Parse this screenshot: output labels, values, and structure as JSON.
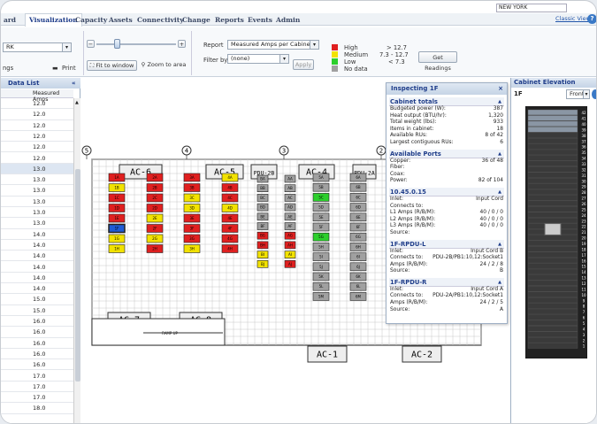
{
  "nav": {
    "items": [
      "ard",
      "Visualization",
      "Capacity",
      "Assets",
      "Connectivity",
      "Change",
      "Reports",
      "Events",
      "Admin"
    ],
    "sub": "ps",
    "location": "NEW YORK",
    "classic_view": "Classic View",
    "help": "?"
  },
  "toolbar": {
    "site_select": "RK",
    "rings": "ngs",
    "print": "Print",
    "minus": "−",
    "plus": "+",
    "fit_to_window": "Fit to window",
    "zoom_to_area": "Zoom to area",
    "report_label": "Report",
    "report_value": "Measured Amps per Cabinet",
    "filter_label": "Filter by",
    "filter_value": "(none)",
    "apply": "Apply",
    "get_readings": "Get Readings",
    "legend": [
      {
        "label": "High",
        "range": "> 12.7",
        "color": "#e02020"
      },
      {
        "label": "Medium",
        "range": "7.3 - 12.7",
        "color": "#f2e200"
      },
      {
        "label": "Low",
        "range": "< 7.3",
        "color": "#2ccf2c"
      },
      {
        "label": "No data",
        "range": "",
        "color": "#a0a0a0"
      }
    ]
  },
  "data_list": {
    "title": "Data List",
    "collapse": "«",
    "column": "Measured Amps",
    "rows": [
      "12.0",
      "12.0",
      "12.0",
      "12.0",
      "12.0",
      "12.0",
      "13.0",
      "13.0",
      "13.0",
      "13.0",
      "13.0",
      "13.0",
      "14.0",
      "14.0",
      "14.0",
      "14.0",
      "14.0",
      "14.0",
      "15.0",
      "15.0",
      "16.0",
      "16.0",
      "16.0",
      "16.0",
      "16.0",
      "17.0",
      "17.0",
      "17.0",
      "18.0"
    ],
    "selected_index": 6
  },
  "floor": {
    "columns": [
      "5",
      "4",
      "3",
      "2"
    ],
    "units": [
      "AC-6",
      "AC-5",
      "PDU-2B",
      "AC-4",
      "PDU-2A",
      "AC-7",
      "AC-8",
      "AC-1",
      "AC-2"
    ],
    "ramp_label": "RAMP UP",
    "row1": {
      "labels": [
        "1A",
        "1B",
        "1C",
        "1D",
        "1E",
        "1F",
        "1G",
        "1H"
      ],
      "colors": [
        "red",
        "yellow",
        "red",
        "red",
        "red",
        "blue",
        "yellow",
        "yellow"
      ]
    },
    "row2": {
      "labels": [
        "2A",
        "2B",
        "2C",
        "2D",
        "2E",
        "2F",
        "2G",
        "2H"
      ],
      "colors": [
        "red",
        "red",
        "red",
        "red",
        "yellow",
        "red",
        "yellow",
        "red"
      ]
    },
    "row3": {
      "labels": [
        "3A",
        "3B",
        "3C",
        "3D",
        "3E",
        "3F",
        "3G",
        "3H"
      ],
      "colors": [
        "red",
        "red",
        "yellow",
        "yellow",
        "red",
        "red",
        "red",
        "yellow"
      ]
    },
    "row4": {
      "labels": [
        "4A",
        "4B",
        "4C",
        "4D",
        "4E",
        "4F",
        "4G",
        "4H"
      ],
      "colors": [
        "yellow",
        "red",
        "red",
        "yellow",
        "red",
        "red",
        "red",
        "red"
      ]
    },
    "row5": {
      "labels": [
        "BA",
        "BB",
        "BC",
        "BD",
        "BE",
        "BF",
        "BG",
        "BH",
        "BI",
        "BJ"
      ],
      "colors": [
        "gray",
        "gray",
        "gray",
        "gray",
        "gray",
        "gray",
        "red",
        "red",
        "yellow",
        "yellow"
      ]
    },
    "row6": {
      "labels": [
        "AA",
        "AB",
        "AC",
        "AD",
        "AE",
        "AF",
        "AG",
        "AH",
        "AI",
        "AJ"
      ],
      "colors": [
        "gray",
        "gray",
        "gray",
        "gray",
        "gray",
        "gray",
        "red",
        "red",
        "yellow",
        "red"
      ]
    },
    "row7": {
      "labels": [
        "5A",
        "5B",
        "5C",
        "5D",
        "5E",
        "5F",
        "5G",
        "5H",
        "5I",
        "5J",
        "5K",
        "5L",
        "5M"
      ],
      "colors": [
        "gray",
        "gray",
        "green",
        "gray",
        "gray",
        "gray",
        "green",
        "gray",
        "gray",
        "gray",
        "gray",
        "gray",
        "gray"
      ]
    },
    "row8": {
      "labels": [
        "6A",
        "6B",
        "6C",
        "6D",
        "6E",
        "6F",
        "6G",
        "6H",
        "6I",
        "6J",
        "6K",
        "6L",
        "6M"
      ],
      "colors": [
        "gray",
        "gray",
        "gray",
        "gray",
        "gray",
        "gray",
        "gray",
        "gray",
        "gray",
        "gray",
        "gray",
        "gray",
        "gray"
      ]
    }
  },
  "inspector": {
    "title": "Inspecting 1F",
    "close": "×",
    "sections": [
      {
        "title": "Cabinet totals",
        "rows": [
          [
            "Budgeted power (W):",
            "387"
          ],
          [
            "Heat output (BTU/hr):",
            "1,320"
          ],
          [
            "Total weight (lbs):",
            "933"
          ],
          [
            "Items in cabinet:",
            "18"
          ],
          [
            "Available RUs:",
            "8 of 42"
          ],
          [
            "Largest contiguous RUs:",
            "6"
          ]
        ]
      },
      {
        "title": "Available Ports",
        "rows": [
          [
            "Copper:",
            "36 of 48"
          ],
          [
            "Fiber:",
            ""
          ],
          [
            "Coax:",
            ""
          ],
          [
            "Power:",
            "82 of 104"
          ]
        ]
      },
      {
        "title": "10.45.0.15",
        "rows": [
          [
            "Inlet:",
            "Input Cord"
          ],
          [
            "Connects to:",
            ""
          ],
          [
            "L1 Amps (R/B/M):",
            "40 / 0 / 0"
          ],
          [
            "L2 Amps (R/B/M):",
            "40 / 0 / 0"
          ],
          [
            "L3 Amps (R/B/M):",
            "40 / 0 / 0"
          ],
          [
            "Source:",
            ""
          ]
        ]
      },
      {
        "title": "1F-RPDU-L",
        "rows": [
          [
            "Inlet:",
            "Input Cord B"
          ],
          [
            "Connects to:",
            "PDU-2B/PB1:10,12:Socket1"
          ],
          [
            "Amps (R/B/M):",
            "24 / 2 / 8"
          ],
          [
            "Source:",
            "B"
          ]
        ]
      },
      {
        "title": "1F-RPDU-R",
        "rows": [
          [
            "Inlet:",
            "Input Cord A"
          ],
          [
            "Connects to:",
            "PDU-2A/PB1:10,12:Socket1"
          ],
          [
            "Amps (R/B/M):",
            "24 / 2 / 5"
          ],
          [
            "Source:",
            "A"
          ]
        ]
      }
    ]
  },
  "elevation": {
    "title": "Cabinet Elevation",
    "cabinet": "1F",
    "view": "Front",
    "rack_units": [
      "42",
      "41",
      "40",
      "39",
      "38",
      "37",
      "36",
      "35",
      "34",
      "33",
      "32",
      "31",
      "30",
      "29",
      "28",
      "27",
      "26",
      "25",
      "24",
      "23",
      "22",
      "21",
      "20",
      "19",
      "18",
      "17",
      "16",
      "15",
      "14",
      "13",
      "12",
      "11",
      "10",
      "9",
      "8",
      "7",
      "6",
      "5",
      "4",
      "3",
      "2",
      "1"
    ]
  }
}
